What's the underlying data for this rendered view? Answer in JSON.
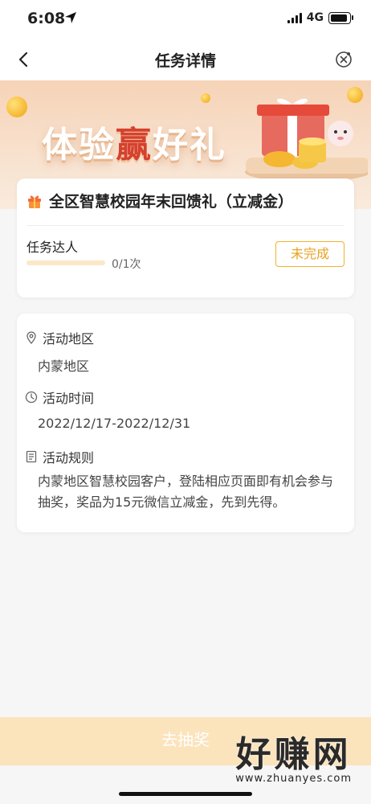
{
  "status_bar": {
    "time": "6:08",
    "network": "4G"
  },
  "nav": {
    "title": "任务详情"
  },
  "banner": {
    "title_prefix": "体验",
    "title_highlight": "赢",
    "title_suffix": "好礼"
  },
  "task": {
    "title": "全区智慧校园年末回馈礼（立减金）",
    "name": "任务达人",
    "progress_text": "0/1次",
    "progress_fraction": 0,
    "status_label": "未完成"
  },
  "info": {
    "region_label": "活动地区",
    "region_value": "内蒙地区",
    "time_label": "活动时间",
    "time_value": "2022/12/17-2022/12/31",
    "rules_label": "活动规则",
    "rules_text": "内蒙地区智慧校园客户，登陆相应页面即有机会参与抽奖，奖品为15元微信立减金，先到先得。"
  },
  "bottom": {
    "button_label": "去抽奖"
  },
  "watermark": {
    "brand": "好赚网",
    "url": "www.zhuanyes.com"
  },
  "colors": {
    "accent": "#f1b22d",
    "banner_highlight": "#d5412e",
    "bottom_button": "#fbe3bc"
  }
}
